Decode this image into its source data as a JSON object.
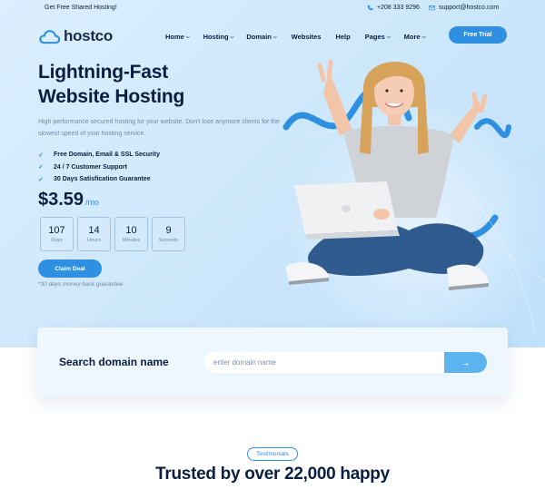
{
  "topbar": {
    "promo": "Get Free Shared Hosting!",
    "phone": "+208 333 9296",
    "email": "support@hostco.com"
  },
  "brand": {
    "name": "hostco"
  },
  "nav": {
    "items": [
      {
        "label": "Home",
        "dropdown": true
      },
      {
        "label": "Hosting",
        "dropdown": true
      },
      {
        "label": "Domain",
        "dropdown": true
      },
      {
        "label": "Websites",
        "dropdown": false
      },
      {
        "label": "Help",
        "dropdown": false
      },
      {
        "label": "Pages",
        "dropdown": true
      },
      {
        "label": "More",
        "dropdown": true
      }
    ],
    "cta": "Free Trial"
  },
  "hero": {
    "headline_line1": "Lightning-Fast",
    "headline_line2": "Website Hosting",
    "description": "High performance secured hosting for your website. Don't lose anymore clients for the slowest speed of your hosting service.",
    "features": [
      "Free Domain, Email & SSL Security",
      "24 / 7 Customer Support",
      "30 Days Satisfication Guarantee"
    ],
    "price": "$3.59",
    "price_period": "/mo",
    "countdown": [
      {
        "value": "107",
        "label": "Days"
      },
      {
        "value": "14",
        "label": "Hours"
      },
      {
        "value": "10",
        "label": "Minutes"
      },
      {
        "value": "9",
        "label": "Seconds"
      }
    ],
    "cta": "Claim Deal",
    "guarantee": "*30 days money back guarantee"
  },
  "search": {
    "title": "Search domain name",
    "placeholder": "enter domain name",
    "value": ""
  },
  "testimonials": {
    "tag": "Testimonials",
    "title": "Trusted by over 22,000 happy"
  },
  "colors": {
    "accent": "#2f8fe0",
    "navy": "#0b1e3f",
    "hero_bg": "#cfe8fb",
    "muted": "#6e8aa6"
  }
}
